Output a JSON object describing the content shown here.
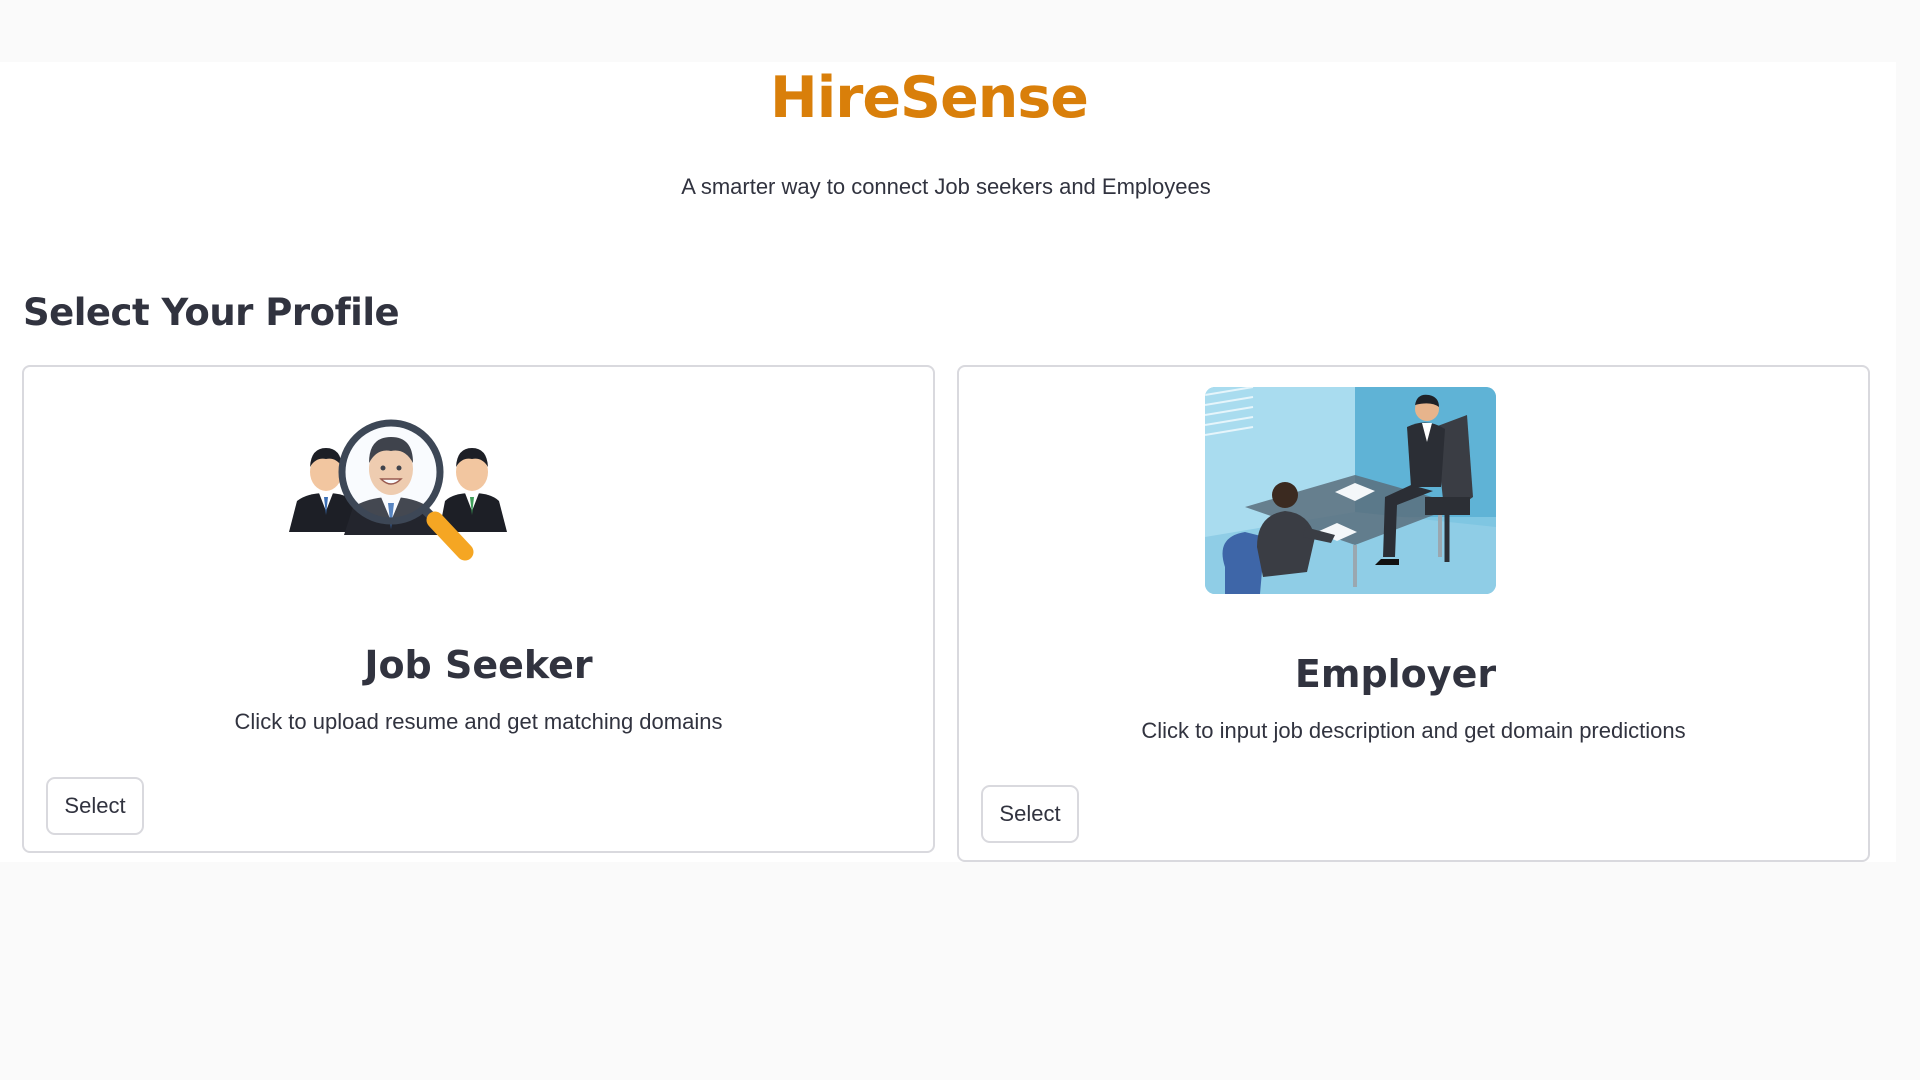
{
  "header": {
    "title": "HireSense",
    "subtitle": "A smarter way to connect Job seekers and Employees"
  },
  "section": {
    "heading": "Select Your Profile"
  },
  "cards": [
    {
      "title": "Job Seeker",
      "description": "Click to upload resume and get matching domains",
      "button_label": "Select",
      "illustration": "candidates-magnifier-illustration"
    },
    {
      "title": "Employer",
      "description": "Click to input job description and get domain predictions",
      "button_label": "Select",
      "illustration": "job-interview-illustration"
    }
  ],
  "colors": {
    "brand": "#d97f0a",
    "text": "#31333f",
    "border": "#d9d9de",
    "page_background": "#fafafa"
  }
}
